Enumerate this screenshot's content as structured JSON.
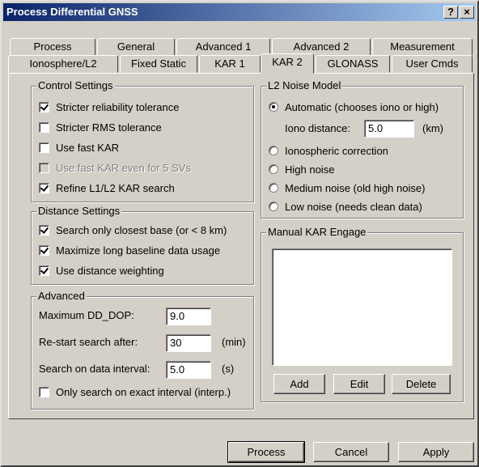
{
  "window": {
    "title": "Process Differential GNSS",
    "help_label": "?",
    "close_label": "×"
  },
  "tabs_back": [
    "Process",
    "General",
    "Advanced 1",
    "Advanced 2",
    "Measurement"
  ],
  "tabs_front": [
    "Ionosphere/L2",
    "Fixed Static",
    "KAR 1",
    "KAR 2",
    "GLONASS",
    "User Cmds"
  ],
  "active_tab": "KAR 2",
  "control_settings": {
    "title": "Control Settings",
    "items": [
      {
        "label": "Stricter reliability tolerance",
        "checked": true,
        "enabled": true
      },
      {
        "label": "Stricter RMS tolerance",
        "checked": false,
        "enabled": true
      },
      {
        "label": "Use fast KAR",
        "checked": false,
        "enabled": true
      },
      {
        "label": "Use fast KAR even for 5 SVs",
        "checked": false,
        "enabled": false
      },
      {
        "label": "Refine L1/L2 KAR search",
        "checked": true,
        "enabled": true
      }
    ]
  },
  "distance_settings": {
    "title": "Distance Settings",
    "items": [
      {
        "label": "Search only closest base (or < 8 km)",
        "checked": true
      },
      {
        "label": "Maximize long baseline data usage",
        "checked": true
      },
      {
        "label": "Use distance weighting",
        "checked": true
      }
    ]
  },
  "advanced": {
    "title": "Advanced",
    "max_dd_dop_label": "Maximum DD_DOP:",
    "max_dd_dop_value": "9.0",
    "restart_label": "Re-start search after:",
    "restart_value": "30",
    "restart_unit": "(min)",
    "interval_label": "Search on data interval:",
    "interval_value": "5.0",
    "interval_unit": "(s)",
    "exact_interval_label": "Only search on exact interval (interp.)",
    "exact_interval_checked": false
  },
  "l2_noise": {
    "title": "L2 Noise Model",
    "automatic_label": "Automatic (chooses iono or high)",
    "iono_distance_label": "Iono distance:",
    "iono_distance_value": "5.0",
    "iono_distance_unit": "(km)",
    "options": [
      {
        "label": "Ionospheric correction",
        "selected": false
      },
      {
        "label": "High noise",
        "selected": false
      },
      {
        "label": "Medium noise (old high noise)",
        "selected": false
      },
      {
        "label": "Low noise (needs clean data)",
        "selected": false
      }
    ],
    "automatic_selected": true
  },
  "manual_kar": {
    "title": "Manual KAR Engage",
    "add_label": "Add",
    "edit_label": "Edit",
    "delete_label": "Delete"
  },
  "footer": {
    "process_label": "Process",
    "cancel_label": "Cancel",
    "apply_label": "Apply"
  }
}
